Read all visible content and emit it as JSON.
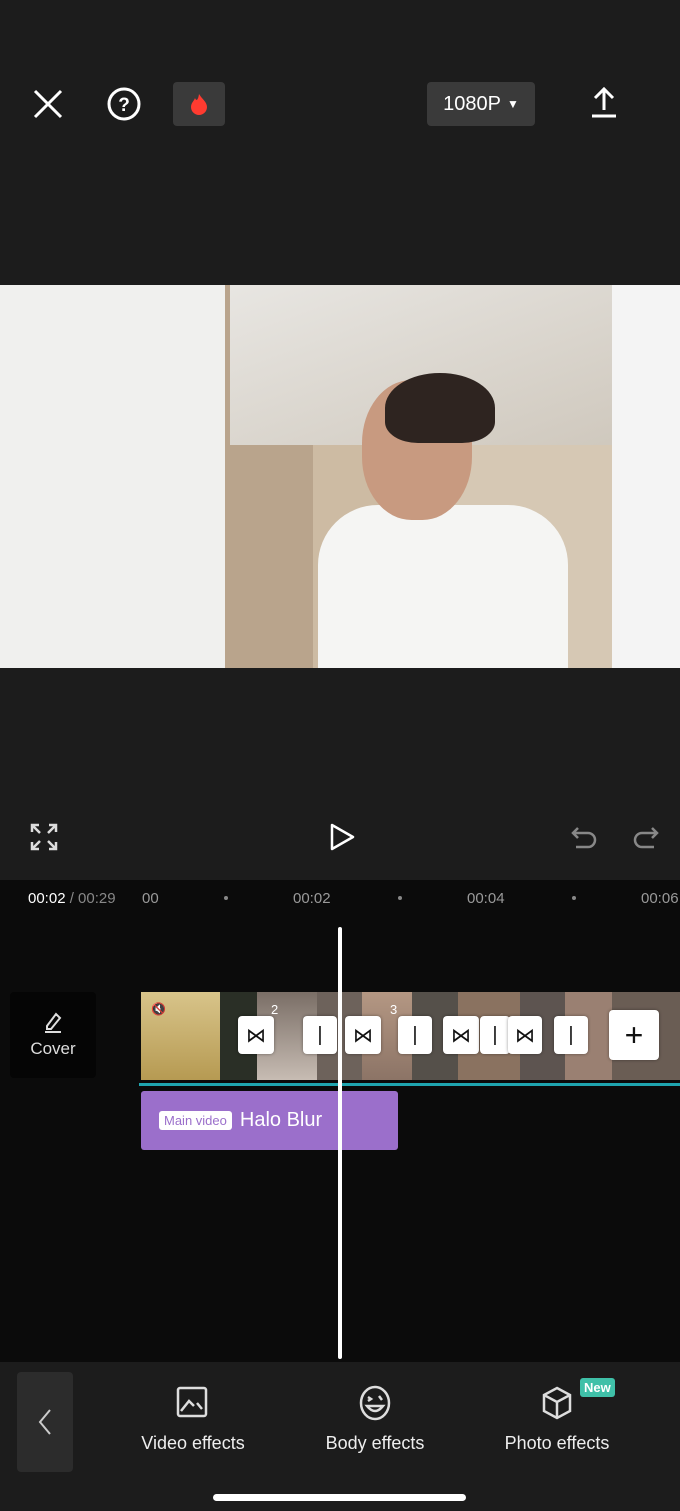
{
  "topbar": {
    "resolution": "1080P",
    "icons": [
      "close-icon",
      "help-icon",
      "fire-icon",
      "upload-icon"
    ]
  },
  "playback": {
    "icons": [
      "fullscreen-icon",
      "play-icon",
      "undo-icon",
      "redo-icon"
    ]
  },
  "timeline": {
    "current_time": "00:02",
    "total_time": "/ 00:29",
    "ticks": [
      "00",
      "00:02",
      "00:04",
      "00:06"
    ],
    "cover_label": "Cover",
    "clip_badges": [
      "2",
      "3"
    ],
    "effect_track": {
      "badge": "Main video",
      "label": "Halo Blur",
      "color": "#9b6fcb"
    },
    "accent": "#1fa5b0"
  },
  "toolbar": {
    "items": [
      {
        "label": "Video effects",
        "icon": "video-effects-icon"
      },
      {
        "label": "Body effects",
        "icon": "body-effects-icon"
      },
      {
        "label": "Photo effects",
        "icon": "photo-effects-icon",
        "badge": "New"
      }
    ],
    "badge_color": "#3fc0a8"
  }
}
